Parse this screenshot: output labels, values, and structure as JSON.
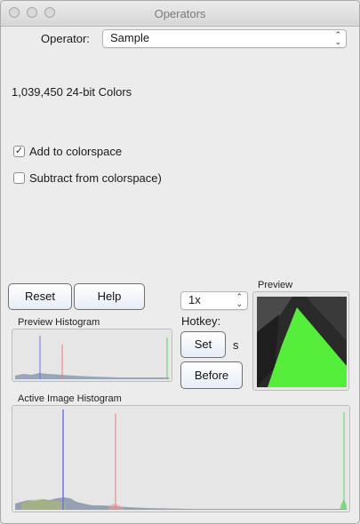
{
  "window": {
    "title": "Operators"
  },
  "operator": {
    "label": "Operator:",
    "selected": "Sample"
  },
  "colors_text": "1,039,450 24-bit Colors",
  "checkboxes": [
    {
      "label": "Add to colorspace",
      "checked": true
    },
    {
      "label": "Subtract from colorspace)",
      "checked": false
    }
  ],
  "buttons": {
    "reset": "Reset",
    "help": "Help",
    "set": "Set",
    "before": "Before"
  },
  "zoom": {
    "selected": "1x"
  },
  "hotkey": {
    "label": "Hotkey:",
    "key": "s"
  },
  "preview": {
    "label": "Preview"
  },
  "histograms": {
    "preview_label": "Preview Histogram",
    "active_label": "Active Image Histogram"
  },
  "colors": {
    "green_patch": "#55ee3a",
    "hist_blue": "#6b74f0",
    "hist_red": "#ee7a7a",
    "hist_green": "#5fd35f"
  }
}
